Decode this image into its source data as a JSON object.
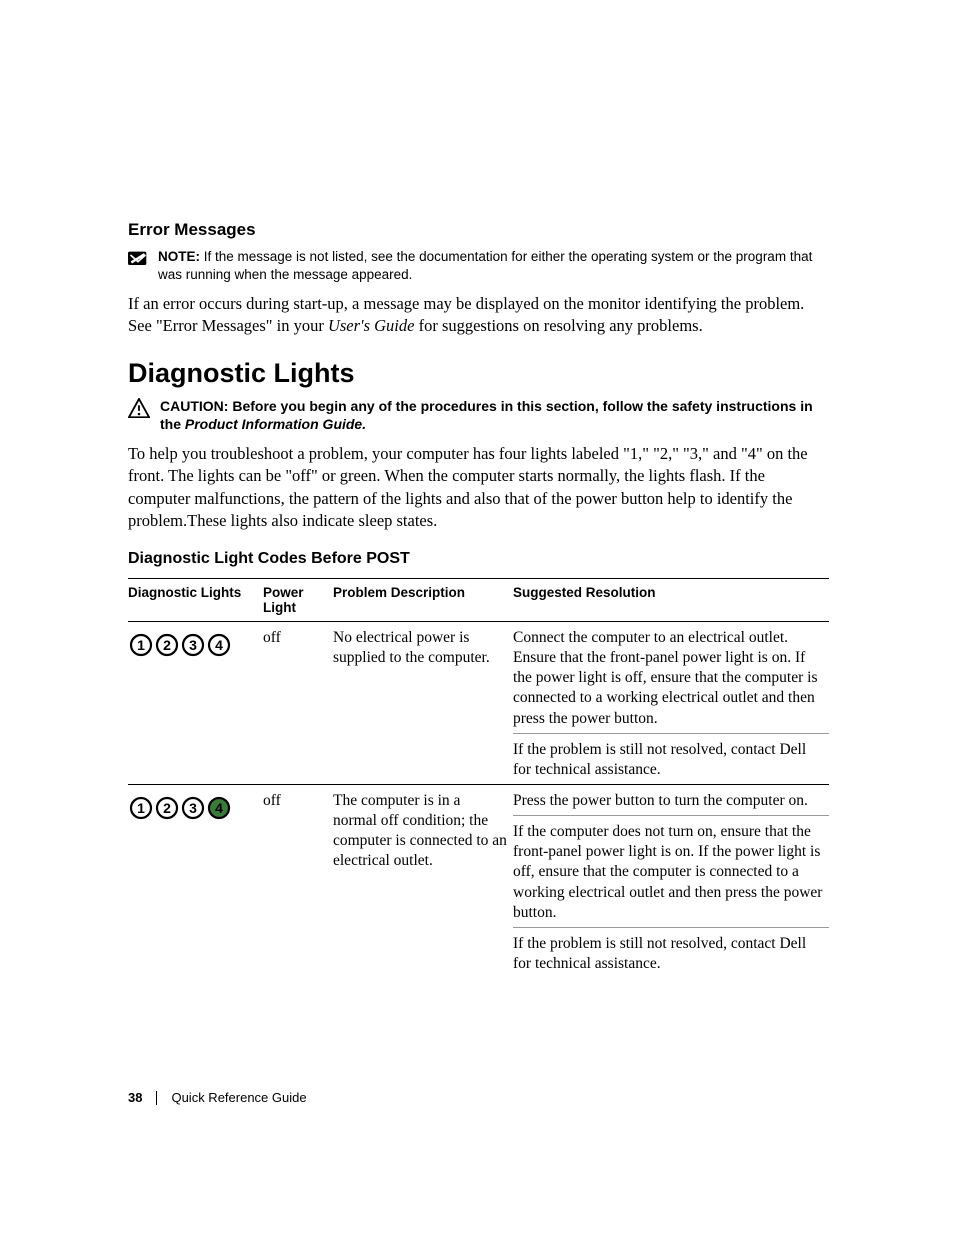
{
  "error_messages": {
    "heading": "Error Messages",
    "note_label": "NOTE:",
    "note_text": " If the message is not listed, see the documentation for either the operating system or the program that was running when the message appeared.",
    "body_pre": "If an error occurs during start-up, a message may be displayed on the monitor identifying the problem. See \"Error Messages\" in your ",
    "body_em": "User's Guide",
    "body_post": " for suggestions on resolving any problems."
  },
  "diagnostic_lights": {
    "heading": "Diagnostic Lights",
    "caution_label": "CAUTION:",
    "caution_text": " Before you begin any of the procedures in this section, follow the safety instructions in the ",
    "caution_em": "Product Information Guide.",
    "body": "To help you troubleshoot a problem, your computer has four lights labeled \"1,\" \"2,\" \"3,\" and \"4\" on the front. The lights can be \"off\" or green. When the computer starts normally, the lights flash. If the computer malfunctions, the pattern of the lights and also that of the power button help to identify the problem.These lights also indicate sleep states."
  },
  "codes_section": {
    "heading": "Diagnostic Light Codes Before POST",
    "headers": {
      "lights": "Diagnostic Lights",
      "power": "Power Light",
      "problem": "Problem Description",
      "resolution": "Suggested Resolution"
    },
    "rows": [
      {
        "lights_state": [
          "off",
          "off",
          "off",
          "off"
        ],
        "power": "off",
        "problem": "No electrical power is supplied to the computer.",
        "resolutions": [
          "Connect the computer to an electrical outlet. Ensure that the front-panel power light is on. If the power light is off, ensure that the computer is connected to a working electrical outlet and then press the power button.",
          "If the problem is still not resolved, contact Dell for technical assistance."
        ]
      },
      {
        "lights_state": [
          "off",
          "off",
          "off",
          "on"
        ],
        "power": "off",
        "problem": "The computer is in a normal off condition; the computer is connected to an electrical outlet.",
        "resolutions": [
          "Press the power button to turn the computer on.",
          "If the computer does not turn on, ensure that the front-panel power light is on. If the power light is off, ensure that the computer is connected to a working electrical outlet and then press the power button.",
          "If the problem is still not resolved, contact Dell for technical assistance."
        ]
      }
    ]
  },
  "footer": {
    "page": "38",
    "title": "Quick Reference Guide"
  }
}
